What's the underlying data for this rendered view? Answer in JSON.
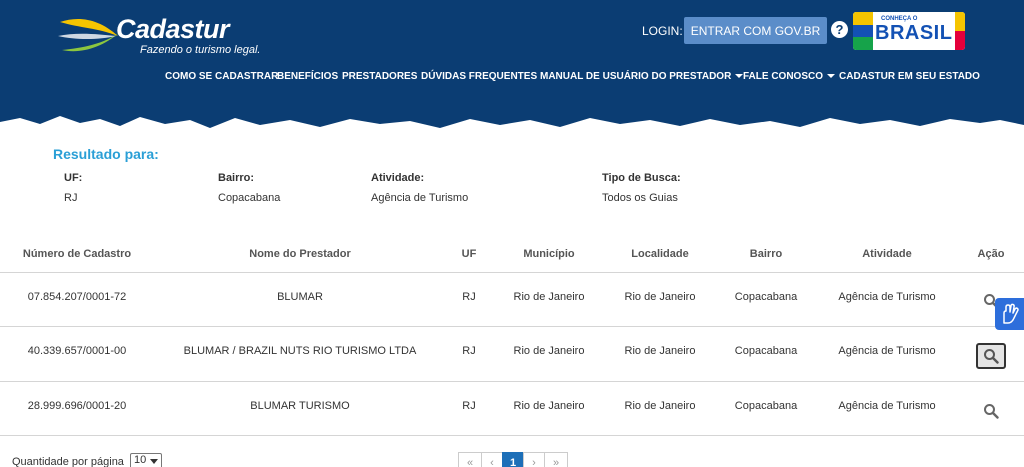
{
  "header": {
    "logo_name": "Cadastur",
    "logo_tagline": "Fazendo o turismo legal.",
    "login_label": "LOGIN:",
    "govbr_button": "ENTRAR COM GOV.BR",
    "help_symbol": "?",
    "brasil_small": "CONHEÇA O",
    "brasil_big": "BRASIL",
    "nav": [
      {
        "label": "COMO SE CADASTRAR"
      },
      {
        "label": "BENEFÍCIOS"
      },
      {
        "label": "PRESTADORES"
      },
      {
        "label": "DÚVIDAS FREQUENTES"
      },
      {
        "label": "MANUAL DE USUÁRIO DO PRESTADOR"
      },
      {
        "label": "FALE CONOSCO"
      },
      {
        "label": "CADASTUR EM SEU ESTADO"
      }
    ],
    "colors": {
      "background": "#0b3d73",
      "button": "#5b8dc9"
    }
  },
  "result": {
    "title": "Resultado para:",
    "fields": [
      {
        "label": "UF:",
        "value": "RJ"
      },
      {
        "label": "Bairro:",
        "value": "Copacabana"
      },
      {
        "label": "Atividade:",
        "value": "Agência de Turismo"
      },
      {
        "label": "Tipo de Busca:",
        "value": "Todos os Guias"
      }
    ]
  },
  "table": {
    "headers": [
      "Número de Cadastro",
      "Nome do Prestador",
      "UF",
      "Município",
      "Localidade",
      "Bairro",
      "Atividade",
      "Ação"
    ],
    "rows": [
      {
        "cadastro": "07.854.207/0001-72",
        "nome": "BLUMAR",
        "uf": "RJ",
        "municipio": "Rio de Janeiro",
        "localidade": "Rio de Janeiro",
        "bairro": "Copacabana",
        "atividade": "Agência de Turismo",
        "acao_icon": "search-icon"
      },
      {
        "cadastro": "40.339.657/0001-00",
        "nome": "BLUMAR / BRAZIL NUTS RIO TURISMO LTDA",
        "uf": "RJ",
        "municipio": "Rio de Janeiro",
        "localidade": "Rio de Janeiro",
        "bairro": "Copacabana",
        "atividade": "Agência de Turismo",
        "acao_icon": "search-icon"
      },
      {
        "cadastro": "28.999.696/0001-20",
        "nome": "BLUMAR TURISMO",
        "uf": "RJ",
        "municipio": "Rio de Janeiro",
        "localidade": "Rio de Janeiro",
        "bairro": "Copacabana",
        "atividade": "Agência de Turismo",
        "acao_icon": "search-icon"
      }
    ]
  },
  "footer": {
    "per_page_label": "Quantidade por página",
    "per_page_value": "10",
    "pagination": {
      "first": "«",
      "prev": "‹",
      "current": "1",
      "next": "›",
      "last": "»"
    }
  },
  "accessibility_icon": "sign-language-icon"
}
